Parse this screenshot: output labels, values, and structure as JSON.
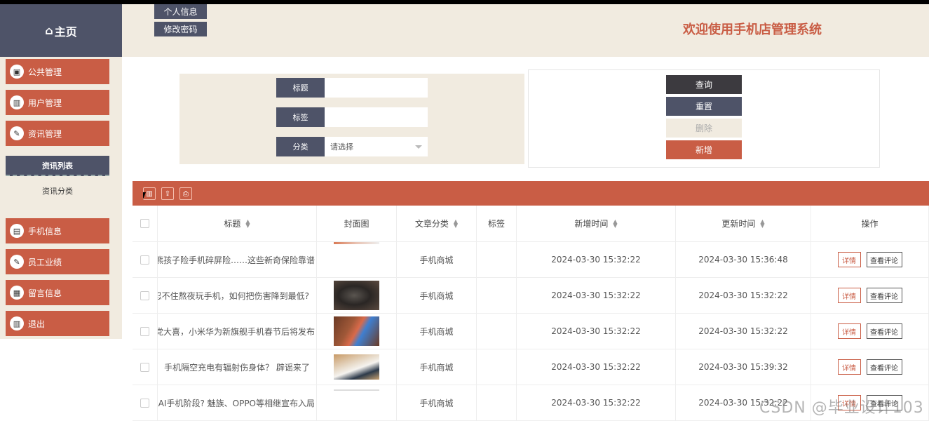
{
  "header": {
    "home_label": "主页",
    "home_icon": "home-icon",
    "personal_info": "个人信息",
    "change_password": "修改密码",
    "site_title": "欢迎使用手机店管理系统"
  },
  "sidebar": {
    "items": [
      {
        "label": "公共管理",
        "icon": "public-icon"
      },
      {
        "label": "用户管理",
        "icon": "chart-icon"
      },
      {
        "label": "资讯管理",
        "icon": "edit-icon"
      },
      {
        "label": "手机信息",
        "icon": "clipboard-icon"
      },
      {
        "label": "员工业绩",
        "icon": "edit-icon"
      },
      {
        "label": "留言信息",
        "icon": "message-icon"
      },
      {
        "label": "退出",
        "icon": "chart-icon"
      }
    ],
    "sub_items": [
      {
        "label": "资讯列表",
        "active": true
      },
      {
        "label": "资讯分类",
        "active": false
      }
    ]
  },
  "search": {
    "title_label": "标题",
    "tag_label": "标签",
    "category_label": "分类",
    "category_placeholder": "请选择"
  },
  "actions": {
    "query": "查询",
    "reset": "重置",
    "delete": "删除",
    "add": "新增"
  },
  "table": {
    "columns": [
      "标题",
      "封面图",
      "文章分类",
      "标签",
      "新增时间",
      "更新时间",
      "操作"
    ],
    "rows": [
      {
        "title": "险熊孩子险手机碎屏险……这些新奇保险靠谱",
        "category": "手机商城",
        "tag": "",
        "created": "2024-03-30 15:32:22",
        "updated": "2024-03-30 15:36:48"
      },
      {
        "title": "忍不住熬夜玩手机，如何把伤害降到最低?",
        "category": "手机商城",
        "tag": "",
        "created": "2024-03-30 15:32:22",
        "updated": "2024-03-30 15:32:22"
      },
      {
        "title": "等党大喜，小米华为新旗舰手机春节后将发布",
        "category": "手机商城",
        "tag": "",
        "created": "2024-03-30 15:32:22",
        "updated": "2024-03-30 15:32:22"
      },
      {
        "title": "手机隔空充电有辐射伤身体？ 辟谣来了",
        "category": "手机商城",
        "tag": "",
        "created": "2024-03-30 15:32:22",
        "updated": "2024-03-30 15:39:32"
      },
      {
        "title": "进入AI手机阶段? 魅族、OPPO等相继宣布入局",
        "category": "手机商城",
        "tag": "",
        "created": "2024-03-30 15:32:22",
        "updated": "2024-03-30 15:32:22"
      }
    ],
    "detail_label": "详情",
    "view_comments_label": "查看评论"
  },
  "watermark": "CSDN @毕业设计103",
  "colors": {
    "accent": "#c95d45",
    "dark": "#4e5368",
    "beige": "#f1ebe0",
    "query_btn": "#3c3a3f"
  }
}
